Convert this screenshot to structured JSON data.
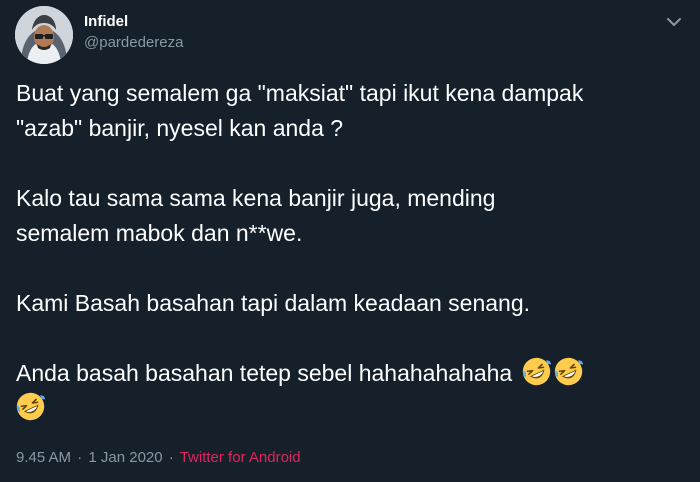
{
  "author": {
    "display_name": "Infidel",
    "handle": "@pardedereza"
  },
  "tweet": {
    "paragraphs": [
      [
        "Buat yang semalem ga \"maksiat\" tapi ikut kena dampak",
        "\"azab\" banjir, nyesel kan anda ?"
      ],
      [
        "Kalo tau sama sama kena banjir juga, mending",
        "semalem mabok dan n**we."
      ],
      [
        "Kami Basah basahan tapi dalam keadaan senang."
      ],
      [
        "Anda basah basahan tetep sebel hahahahahaha"
      ]
    ],
    "emojis": [
      "rolling-on-the-floor-laughing-emoji",
      "rolling-on-the-floor-laughing-emoji",
      "rolling-on-the-floor-laughing-emoji"
    ]
  },
  "meta": {
    "time": "9.45 AM",
    "separator": "·",
    "date": "1 Jan 2020",
    "source": "Twitter for Android"
  },
  "icons": {
    "menu": "chevron-down-icon",
    "avatar": "avatar"
  },
  "colors": {
    "background": "#15202b",
    "text": "#ffffff",
    "secondary_text": "#8899a6",
    "source_link": "#e0245e"
  }
}
